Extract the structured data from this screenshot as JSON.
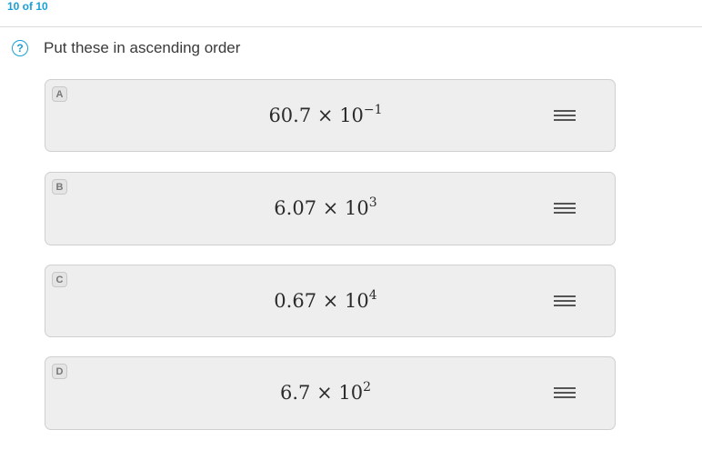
{
  "header": {
    "progress": "10 of 10"
  },
  "question": {
    "icon": "help-circle-icon",
    "text": "Put these in ascending order"
  },
  "options": [
    {
      "letter": "A",
      "mantissa": "60.7",
      "times": "×",
      "base": "10",
      "exponent": "−1"
    },
    {
      "letter": "B",
      "mantissa": "6.07",
      "times": "×",
      "base": "10",
      "exponent": "3"
    },
    {
      "letter": "C",
      "mantissa": "0.67",
      "times": "×",
      "base": "10",
      "exponent": "4"
    },
    {
      "letter": "D",
      "mantissa": "6.7",
      "times": "×",
      "base": "10",
      "exponent": "2"
    }
  ],
  "colors": {
    "accent": "#1a9fd6",
    "card_bg": "#eeeeee",
    "card_border": "#cfcfcf"
  }
}
